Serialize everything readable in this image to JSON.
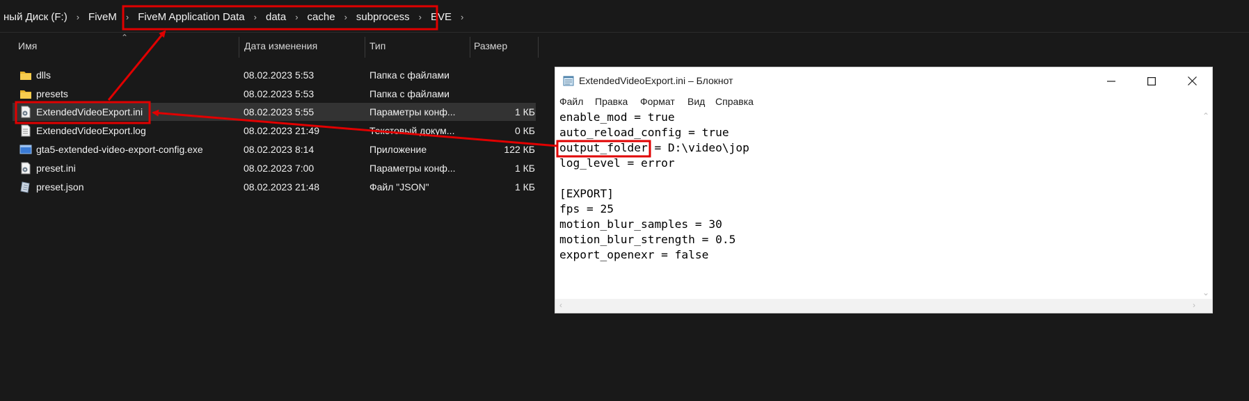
{
  "address_bar": {
    "crumbs": [
      "ный Диск (F:)",
      "FiveM",
      "FiveM Application Data",
      "data",
      "cache",
      "subprocess",
      "EVE"
    ]
  },
  "file_list": {
    "columns": [
      "Имя",
      "Дата изменения",
      "Тип",
      "Размер"
    ],
    "rows": [
      {
        "name": "dlls",
        "date": "08.02.2023 5:53",
        "type": "Папка с файлами",
        "size": "",
        "icon": "folder-icon"
      },
      {
        "name": "presets",
        "date": "08.02.2023 5:53",
        "type": "Папка с файлами",
        "size": "",
        "icon": "folder-icon"
      },
      {
        "name": "ExtendedVideoExport.ini",
        "date": "08.02.2023 5:55",
        "type": "Параметры конф...",
        "size": "1 КБ",
        "icon": "settings-file-icon"
      },
      {
        "name": "ExtendedVideoExport.log",
        "date": "08.02.2023 21:49",
        "type": "Текстовый докум...",
        "size": "0 КБ",
        "icon": "text-file-icon"
      },
      {
        "name": "gta5-extended-video-export-config.exe",
        "date": "08.02.2023 8:14",
        "type": "Приложение",
        "size": "122 КБ",
        "icon": "app-icon"
      },
      {
        "name": "preset.ini",
        "date": "08.02.2023 7:00",
        "type": "Параметры конф...",
        "size": "1 КБ",
        "icon": "settings-file-icon"
      },
      {
        "name": "preset.json",
        "date": "08.02.2023 21:48",
        "type": "Файл \"JSON\"",
        "size": "1 КБ",
        "icon": "json-file-icon"
      }
    ]
  },
  "notepad": {
    "title": "ExtendedVideoExport.ini – Блокнот",
    "menu": [
      "Файл",
      "Правка",
      "Формат",
      "Вид",
      "Справка"
    ],
    "content": "enable_mod = true\nauto_reload_config = true\noutput_folder = D:\\video\\jop\nlog_level = error\n\n[EXPORT]\nfps = 25\nmotion_blur_samples = 30\nmotion_blur_strength = 0.5\nexport_openexr = false"
  },
  "colors": {
    "annotation": "#e00000",
    "explorer_bg": "#191919",
    "selected_row": "#333333"
  }
}
